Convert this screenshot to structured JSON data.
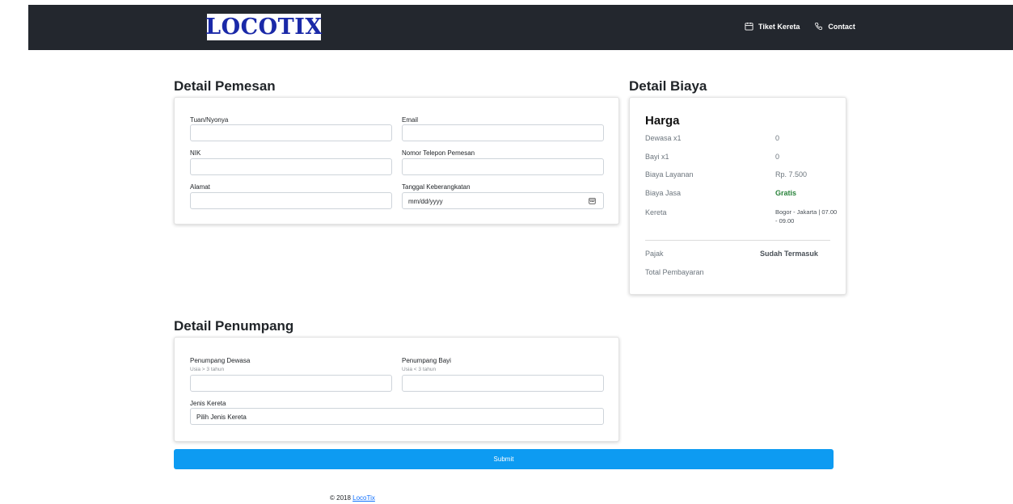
{
  "navbar": {
    "logo_text": "LOCOTIX",
    "links": [
      {
        "label": "Tiket Kereta",
        "icon": "calendar-icon"
      },
      {
        "label": "Contact",
        "icon": "phone-icon"
      }
    ]
  },
  "pemesan": {
    "title": "Detail Pemesan",
    "fields": {
      "tuan_label": "Tuan/Nyonya",
      "email_label": "Email",
      "nik_label": "NIK",
      "telepon_label": "Nomor Telepon Pemesan",
      "alamat_label": "Alamat",
      "tanggal_label": "Tanggal Keberangkatan",
      "tanggal_placeholder": "mm/dd/yyyy"
    }
  },
  "biaya": {
    "title": "Detail Biaya",
    "heading": "Harga",
    "rows": [
      {
        "label": "Dewasa x1",
        "value": "0"
      },
      {
        "label": "Bayi x1",
        "value": "0"
      },
      {
        "label": "Biaya Layanan",
        "value": "Rp. 7.500"
      },
      {
        "label": "Biaya Jasa",
        "value": "Gratis"
      },
      {
        "label": "Kereta",
        "value": "Bogor - Jakarta | 07.00 - 09.00"
      }
    ],
    "pajak_label": "Pajak",
    "pajak_value": "Sudah Termasuk",
    "total_label": "Total Pembayaran"
  },
  "penumpang": {
    "title": "Detail Penumpang",
    "dewasa_label": "Penumpang Dewasa",
    "dewasa_hint": "Usia > 3 tahun",
    "bayi_label": "Penumpang Bayi",
    "bayi_hint": "Usia < 3 tahun",
    "kereta_label": "Jenis Kereta",
    "kereta_selected": "Pilih Jenis Kereta"
  },
  "submit_label": "Submit",
  "footer": {
    "copyright": "© 2018 ",
    "link_text": "LocoTix"
  },
  "colors": {
    "navbar": "#23272e",
    "logo": "#1a29a8",
    "submit": "#0d9bf2",
    "gratis": "#28823a"
  }
}
